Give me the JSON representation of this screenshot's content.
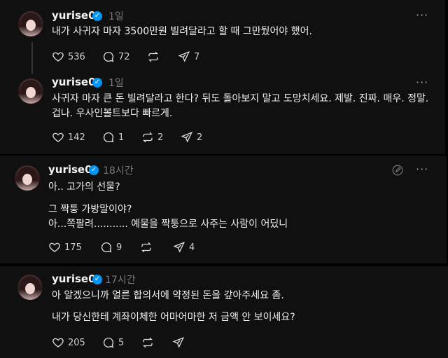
{
  "posts": [
    {
      "username": "yurise0",
      "time": "1일",
      "lines": [
        "내가 사귀자 마자 3500만원 빌려달라고 할 때 그만뒀어야 했어."
      ],
      "likes": "536",
      "comments": "72",
      "reposts": "",
      "shares": "7"
    },
    {
      "username": "yurise0",
      "time": "1일",
      "lines": [
        "사귀자 마자 큰 돈 빌려달라고 한다? 뒤도 돌아보지 말고 도망치세요. 제발. 진짜. 매우. 정말.",
        "겁나. 우사인볼트보다 빠르게."
      ],
      "likes": "142",
      "comments": "1",
      "reposts": "2",
      "shares": "2"
    },
    {
      "username": "yurise0",
      "time": "18시간",
      "lines": [
        "아.. 고가의 선물?",
        "그 짝퉁 가방말이야?",
        "아...쪽팔려........... 예물을 짝퉁으로 사주는 사람이 어딨니"
      ],
      "likes": "175",
      "comments": "9",
      "reposts": "",
      "shares": "4"
    },
    {
      "username": "yurise0",
      "time": "17시간",
      "lines": [
        "아 알겠으니까 얼른 합의서에 약정된 돈을 갚아주세요 좀.",
        "내가 당신한테 계좌이체한 어마어마한 저 금액 안 보이세요?"
      ],
      "likes": "205",
      "comments": "5",
      "reposts": "",
      "shares": ""
    }
  ],
  "verified_mark": "✓",
  "more_glyph": "···",
  "colors": {
    "accent": "#0095f6",
    "background": "#101010",
    "muted": "#7a7a7a"
  }
}
